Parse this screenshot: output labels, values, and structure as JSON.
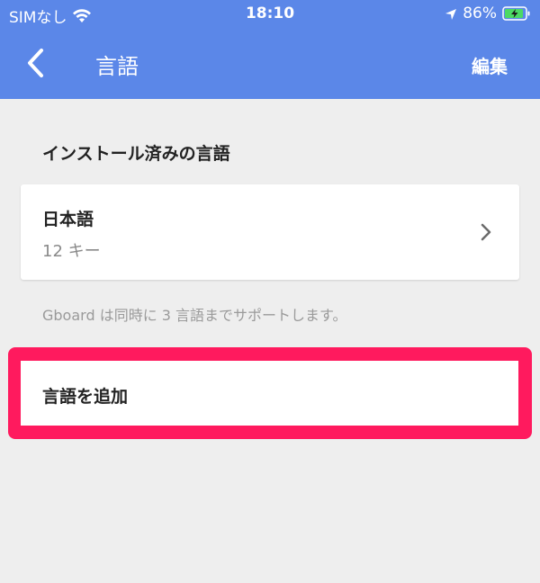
{
  "status_bar": {
    "carrier": "SIMなし",
    "time": "18:10",
    "battery_percent": "86%",
    "icons": [
      "wifi-icon",
      "location-arrow-icon",
      "battery-charging-icon"
    ]
  },
  "header": {
    "title": "言語",
    "edit_label": "編集",
    "back_icon": "chevron-left-icon",
    "color": "#5b87e8"
  },
  "installed_section": {
    "heading": "インストール済みの言語",
    "languages": [
      {
        "name": "日本語",
        "detail": "12 キー"
      }
    ],
    "note": "Gboard は同時に 3 言語までサポートします。"
  },
  "add_language": {
    "label": "言語を追加",
    "highlight_color": "#ff1a5e"
  },
  "colors": {
    "background": "#eeeeee",
    "card": "#ffffff",
    "text_primary": "#222222",
    "text_secondary": "#8a8a8a"
  }
}
